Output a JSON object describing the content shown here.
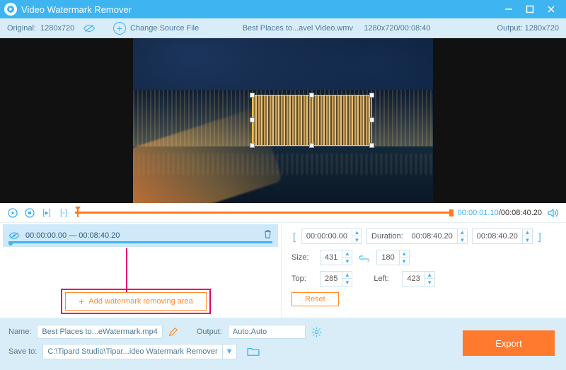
{
  "titlebar": {
    "title": "Video Watermark Remover"
  },
  "toolbar": {
    "original_label": "Original:",
    "original_res": "1280x720",
    "change_source": "Change Source File",
    "file_title": "Best Places to...avel Video.wmv",
    "file_meta": "1280x720/00:08:40",
    "output_label": "Output:",
    "output_res": "1280x720"
  },
  "playbar": {
    "current": "00:00:01.10",
    "total": "00:08:40.20"
  },
  "segment": {
    "start": "00:00:00.00",
    "sep": "—",
    "end": "00:08:40.20"
  },
  "add_area_label": "Add watermark removing area",
  "controls": {
    "start_time": "00:00:00.00",
    "duration_label": "Duration:",
    "duration": "00:08:40.20",
    "end_time": "00:08:40.20",
    "size_label": "Size:",
    "width": "431",
    "height": "180",
    "top_label": "Top:",
    "top": "285",
    "left_label": "Left:",
    "left": "423",
    "reset": "Reset"
  },
  "bottom": {
    "name_label": "Name:",
    "name_value": "Best Places to...eWatermark.mp4",
    "output_label": "Output:",
    "output_value": "Auto;Auto",
    "saveto_label": "Save to:",
    "saveto_value": "C:\\Tipard Studio\\Tipar...ideo Watermark Remover",
    "export": "Export"
  }
}
